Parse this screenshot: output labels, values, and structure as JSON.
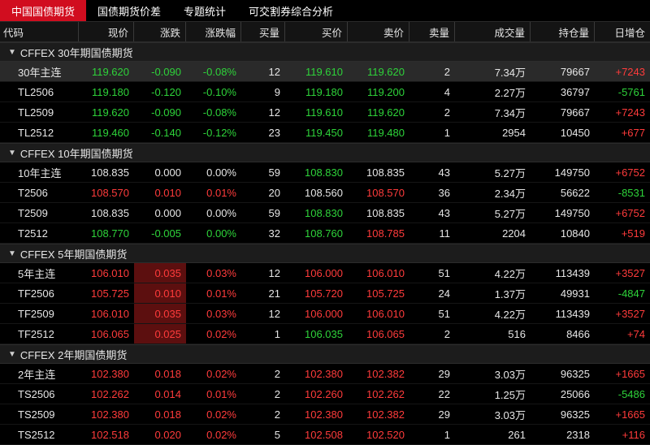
{
  "tabs": [
    "中国国债期货",
    "国债期货价差",
    "专题统计",
    "可交割券综合分析"
  ],
  "columns": [
    "代码",
    "现价",
    "涨跌",
    "涨跌幅",
    "买量",
    "买价",
    "卖价",
    "卖量",
    "成交量",
    "持仓量",
    "日增仓"
  ],
  "colors": {
    "up": "#ff3b3b",
    "down": "#2ed33a",
    "flat": "#e6e6e6",
    "active_tab": "#d10d1f"
  },
  "groups": [
    {
      "title": "CFFEX 30年期国债期货",
      "rows": [
        {
          "code": "30年主连",
          "price": "119.620",
          "chg": "-0.090",
          "pct": "-0.08%",
          "bidv": "12",
          "bid": "119.610",
          "ask": "119.620",
          "askv": "2",
          "vol": "7.34万",
          "oi": "79667",
          "doi": "+7243",
          "dir": "dn",
          "bidc": "dn",
          "askc": "dn",
          "doic": "up",
          "sel": true
        },
        {
          "code": "TL2506",
          "price": "119.180",
          "chg": "-0.120",
          "pct": "-0.10%",
          "bidv": "9",
          "bid": "119.180",
          "ask": "119.200",
          "askv": "4",
          "vol": "2.27万",
          "oi": "36797",
          "doi": "-5761",
          "dir": "dn",
          "bidc": "dn",
          "askc": "dn",
          "doic": "dn"
        },
        {
          "code": "TL2509",
          "price": "119.620",
          "chg": "-0.090",
          "pct": "-0.08%",
          "bidv": "12",
          "bid": "119.610",
          "ask": "119.620",
          "askv": "2",
          "vol": "7.34万",
          "oi": "79667",
          "doi": "+7243",
          "dir": "dn",
          "bidc": "dn",
          "askc": "dn",
          "doic": "up"
        },
        {
          "code": "TL2512",
          "price": "119.460",
          "chg": "-0.140",
          "pct": "-0.12%",
          "bidv": "23",
          "bid": "119.450",
          "ask": "119.480",
          "askv": "1",
          "vol": "2954",
          "oi": "10450",
          "doi": "+677",
          "dir": "dn",
          "bidc": "dn",
          "askc": "dn",
          "doic": "up"
        }
      ]
    },
    {
      "title": "CFFEX 10年期国债期货",
      "rows": [
        {
          "code": "10年主连",
          "price": "108.835",
          "chg": "0.000",
          "pct": "0.00%",
          "bidv": "59",
          "bid": "108.830",
          "ask": "108.835",
          "askv": "43",
          "vol": "5.27万",
          "oi": "149750",
          "doi": "+6752",
          "dir": "fl",
          "bidc": "dn",
          "askc": "fl",
          "doic": "up"
        },
        {
          "code": "T2506",
          "price": "108.570",
          "chg": "0.010",
          "pct": "0.01%",
          "bidv": "20",
          "bid": "108.560",
          "ask": "108.570",
          "askv": "36",
          "vol": "2.34万",
          "oi": "56622",
          "doi": "-8531",
          "dir": "up",
          "bidc": "fl",
          "askc": "up",
          "doic": "dn"
        },
        {
          "code": "T2509",
          "price": "108.835",
          "chg": "0.000",
          "pct": "0.00%",
          "bidv": "59",
          "bid": "108.830",
          "ask": "108.835",
          "askv": "43",
          "vol": "5.27万",
          "oi": "149750",
          "doi": "+6752",
          "dir": "fl",
          "bidc": "dn",
          "askc": "fl",
          "doic": "up"
        },
        {
          "code": "T2512",
          "price": "108.770",
          "chg": "-0.005",
          "pct": "0.00%",
          "bidv": "32",
          "bid": "108.760",
          "ask": "108.785",
          "askv": "11",
          "vol": "2204",
          "oi": "10840",
          "doi": "+519",
          "dir": "dn",
          "bidc": "dn",
          "askc": "up",
          "doic": "up"
        }
      ]
    },
    {
      "title": "CFFEX 5年期国债期货",
      "rows": [
        {
          "code": "5年主连",
          "price": "106.010",
          "chg": "0.035",
          "pct": "0.03%",
          "bidv": "12",
          "bid": "106.000",
          "ask": "106.010",
          "askv": "51",
          "vol": "4.22万",
          "oi": "113439",
          "doi": "+3527",
          "dir": "up",
          "bidc": "up",
          "askc": "up",
          "doic": "up",
          "hl": true
        },
        {
          "code": "TF2506",
          "price": "105.725",
          "chg": "0.010",
          "pct": "0.01%",
          "bidv": "21",
          "bid": "105.720",
          "ask": "105.725",
          "askv": "24",
          "vol": "1.37万",
          "oi": "49931",
          "doi": "-4847",
          "dir": "up",
          "bidc": "up",
          "askc": "up",
          "doic": "dn",
          "hl": true
        },
        {
          "code": "TF2509",
          "price": "106.010",
          "chg": "0.035",
          "pct": "0.03%",
          "bidv": "12",
          "bid": "106.000",
          "ask": "106.010",
          "askv": "51",
          "vol": "4.22万",
          "oi": "113439",
          "doi": "+3527",
          "dir": "up",
          "bidc": "up",
          "askc": "up",
          "doic": "up",
          "hl": true
        },
        {
          "code": "TF2512",
          "price": "106.065",
          "chg": "0.025",
          "pct": "0.02%",
          "bidv": "1",
          "bid": "106.035",
          "ask": "106.065",
          "askv": "2",
          "vol": "516",
          "oi": "8466",
          "doi": "+74",
          "dir": "up",
          "bidc": "dn",
          "askc": "up",
          "doic": "up",
          "hl": true
        }
      ]
    },
    {
      "title": "CFFEX 2年期国债期货",
      "rows": [
        {
          "code": "2年主连",
          "price": "102.380",
          "chg": "0.018",
          "pct": "0.02%",
          "bidv": "2",
          "bid": "102.380",
          "ask": "102.382",
          "askv": "29",
          "vol": "3.03万",
          "oi": "96325",
          "doi": "+1665",
          "dir": "up",
          "bidc": "up",
          "askc": "up",
          "doic": "up"
        },
        {
          "code": "TS2506",
          "price": "102.262",
          "chg": "0.014",
          "pct": "0.01%",
          "bidv": "2",
          "bid": "102.260",
          "ask": "102.262",
          "askv": "22",
          "vol": "1.25万",
          "oi": "25066",
          "doi": "-5486",
          "dir": "up",
          "bidc": "up",
          "askc": "up",
          "doic": "dn"
        },
        {
          "code": "TS2509",
          "price": "102.380",
          "chg": "0.018",
          "pct": "0.02%",
          "bidv": "2",
          "bid": "102.380",
          "ask": "102.382",
          "askv": "29",
          "vol": "3.03万",
          "oi": "96325",
          "doi": "+1665",
          "dir": "up",
          "bidc": "up",
          "askc": "up",
          "doic": "up"
        },
        {
          "code": "TS2512",
          "price": "102.518",
          "chg": "0.020",
          "pct": "0.02%",
          "bidv": "5",
          "bid": "102.508",
          "ask": "102.520",
          "askv": "1",
          "vol": "261",
          "oi": "2318",
          "doi": "+116",
          "dir": "up",
          "bidc": "up",
          "askc": "up",
          "doic": "up"
        }
      ]
    }
  ]
}
